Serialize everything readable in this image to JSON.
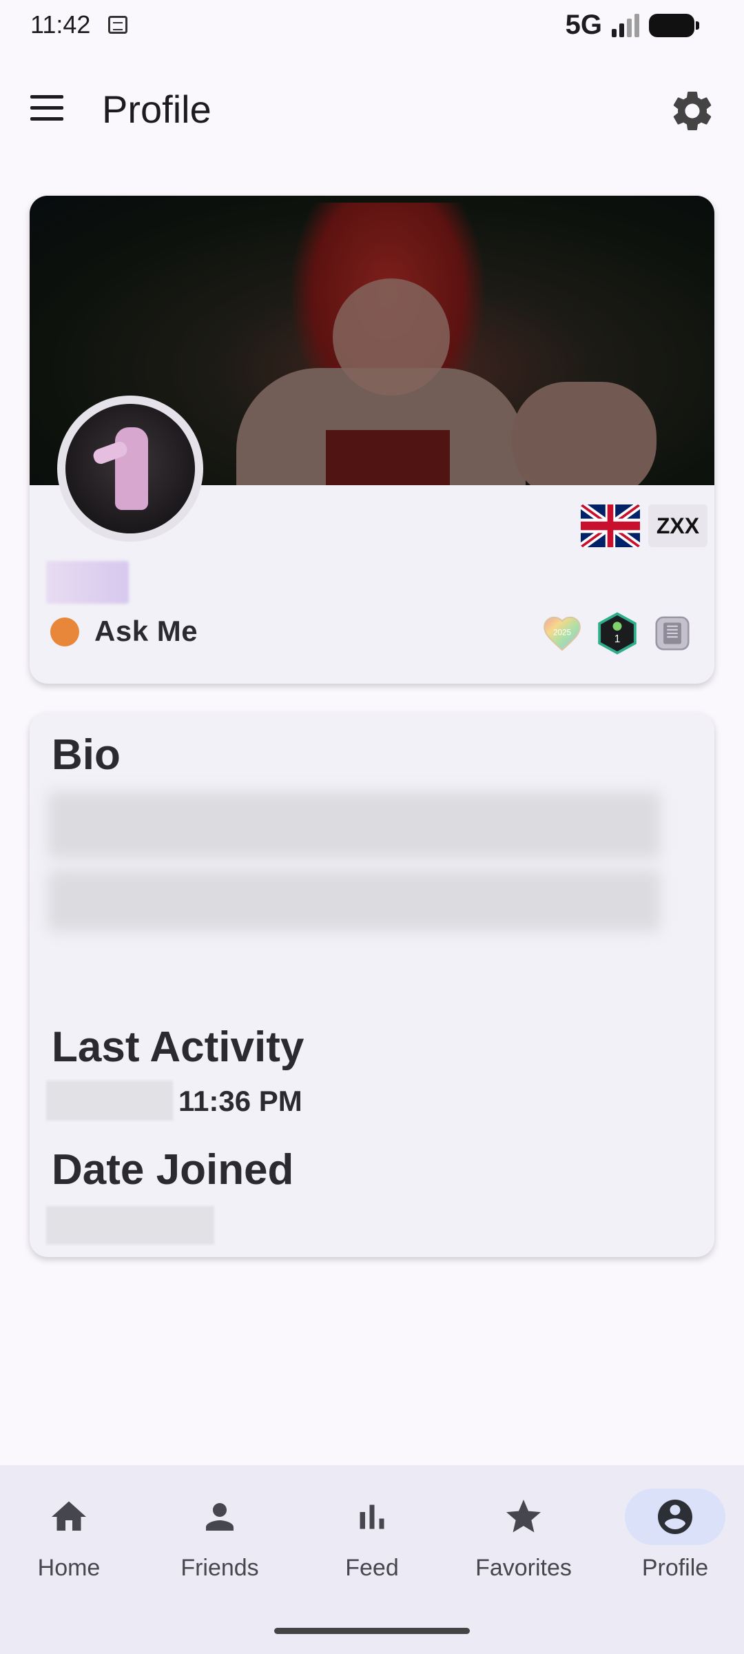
{
  "status_bar": {
    "time": "11:42",
    "network": "5G",
    "icons": [
      "nfc-icon",
      "signal-icon",
      "battery-icon"
    ]
  },
  "app_bar": {
    "title": "Profile",
    "menu_icon": "hamburger-menu-icon",
    "settings_icon": "gear-icon"
  },
  "profile": {
    "language_code": "ZXX",
    "flag": "uk-flag",
    "status_text": "Ask Me",
    "status_color": "#e8863a",
    "badges": [
      "pride-heart-2025-badge",
      "hex-1-year-badge",
      "device-badge"
    ],
    "badge_label": "2025"
  },
  "bio": {
    "title": "Bio"
  },
  "last_activity": {
    "title": "Last Activity",
    "time": "11:36 PM"
  },
  "date_joined": {
    "title": "Date Joined"
  },
  "bottom_nav": {
    "items": [
      {
        "label": "Home",
        "icon": "home-icon",
        "active": false
      },
      {
        "label": "Friends",
        "icon": "person-icon",
        "active": false
      },
      {
        "label": "Feed",
        "icon": "bar-chart-icon",
        "active": false
      },
      {
        "label": "Favorites",
        "icon": "star-icon",
        "active": false
      },
      {
        "label": "Profile",
        "icon": "account-circle-icon",
        "active": true
      }
    ],
    "active_bg": "#dbe1f9"
  }
}
